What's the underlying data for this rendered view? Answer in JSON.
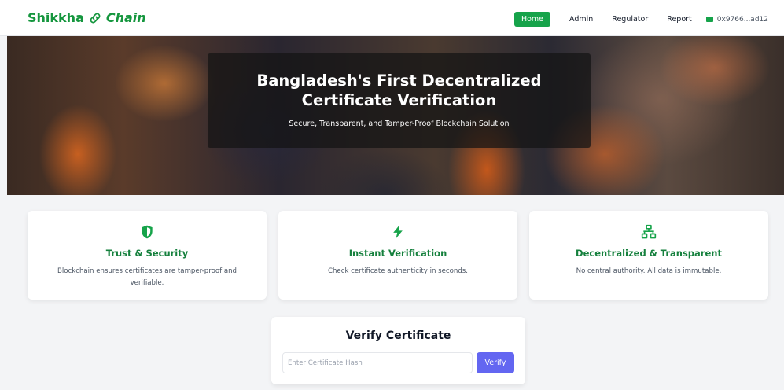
{
  "brand": {
    "name_part1": "Shikkha",
    "name_part2": "Chain",
    "icon": "link-icon",
    "color": "#15963e"
  },
  "nav": {
    "items": [
      {
        "label": "Home",
        "active": true
      },
      {
        "label": "Admin",
        "active": false
      },
      {
        "label": "Regulator",
        "active": false
      },
      {
        "label": "Report",
        "active": false
      }
    ],
    "wallet_address": "0x9766...ad12",
    "wallet_icon": "wallet-icon",
    "active_color": "#16a34a"
  },
  "hero": {
    "title_line1": "Bangladesh's First Decentralized",
    "title_line2": "Certificate Verification",
    "subtitle": "Secure, Transparent, and Tamper-Proof Blockchain Solution"
  },
  "features": [
    {
      "icon": "shield-icon",
      "title": "Trust & Security",
      "description": "Blockchain ensures certificates are tamper-proof and verifiable."
    },
    {
      "icon": "lightning-icon",
      "title": "Instant Verification",
      "description": "Check certificate authenticity in seconds."
    },
    {
      "icon": "network-icon",
      "title": "Decentralized & Transparent",
      "description": "No central authority. All data is immutable."
    }
  ],
  "verify": {
    "title": "Verify Certificate",
    "input_placeholder": "Enter Certificate Hash",
    "input_value": "",
    "button_label": "Verify",
    "button_color": "#6366f1"
  }
}
